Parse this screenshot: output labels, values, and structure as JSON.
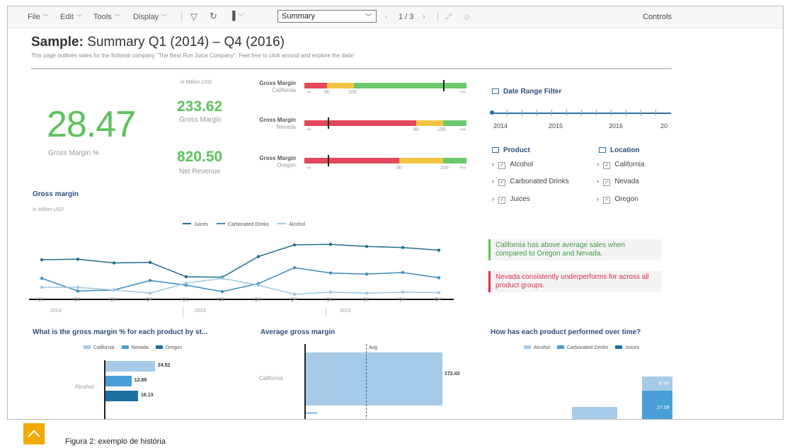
{
  "toolbar": {
    "file": "File",
    "edit": "Edit",
    "tools": "Tools",
    "display": "Display",
    "page_select": "Summary",
    "pager": "1 / 3",
    "controls": "Controls"
  },
  "header": {
    "title_bold": "Sample:",
    "title_rest": " Summary Q1 (2014) – Q4 (2016)",
    "description": "This page outlines sales for the fictional company \"The Best Run Juice Company\". Feel free to click around and explore the data!"
  },
  "kpis": {
    "unit": "in Million USD",
    "gross_margin_pct_value": "28.47",
    "gross_margin_pct_label": "Gross Margin %",
    "gross_margin_value": "233.62",
    "gross_margin_label": "Gross Margin",
    "net_revenue_value": "820.50",
    "net_revenue_label": "Net Revenue"
  },
  "bullets": [
    {
      "title": "Gross Margin",
      "location": "California",
      "ticks": [
        "-∞",
        "80",
        "100",
        "+∞"
      ],
      "marker_pct": 0.93
    },
    {
      "title": "Gross Margin",
      "location": "Nevada",
      "ticks": [
        "-∞",
        "80",
        "100",
        "+∞"
      ],
      "marker_pct": 0.15
    },
    {
      "title": "Gross Margin",
      "location": "Oregon",
      "ticks": [
        "-∞",
        "80",
        "100",
        "+∞"
      ],
      "marker_pct": 0.15
    }
  ],
  "filters": {
    "date_title": "Date Range Filter",
    "years": [
      "2014",
      "2015",
      "2016",
      "20"
    ],
    "product_title": "Product",
    "products": [
      "Alcohol",
      "Carbonated Drinks",
      "Juices"
    ],
    "location_title": "Location",
    "locations": [
      "California",
      "Nevada",
      "Oregon"
    ]
  },
  "notes": {
    "green": "California has above average sales when compared to Oregon and Nevada.",
    "red": "Nevada consistently underperforms for across all product groups.",
    "green_color": "#5dc25d",
    "red_color": "#d9304f"
  },
  "gross_margin_chart": {
    "title": "Gross margin",
    "unit": "in Million USD",
    "quarters": [
      "Q1",
      "Q2",
      "Q3",
      "Q4",
      "Q1",
      "Q2",
      "Q3",
      "Q4",
      "Q1",
      "Q2",
      "Q3",
      "Q4"
    ],
    "years": [
      "2014",
      "2015",
      "2016"
    ]
  },
  "bottom": {
    "chart1_title": "What is the gross margin % for each product by st...",
    "chart1_category": "Alcohol",
    "chart2_title": "Average gross margin",
    "chart2_category": "California",
    "chart2_avg": "Avg",
    "chart3_title": "How has each product performed over time?"
  },
  "chart_data": [
    {
      "type": "line",
      "title": "Gross margin",
      "ylabel": "in Million USD",
      "x": [
        "Q1 2014",
        "Q2 2014",
        "Q3 2014",
        "Q4 2014",
        "Q1 2015",
        "Q2 2015",
        "Q3 2015",
        "Q4 2015",
        "Q1 2016",
        "Q2 2016",
        "Q3 2016",
        "Q4 2016"
      ],
      "ylim": [
        0,
        100
      ],
      "series": [
        {
          "name": "Juices",
          "color": "#1f6f8b",
          "values": [
            72,
            73,
            66,
            67,
            40,
            39,
            78,
            100,
            101,
            97,
            95,
            90
          ]
        },
        {
          "name": "Carbonated Drinks",
          "color": "#3a8dbf",
          "values": [
            37,
            13,
            15,
            33,
            24,
            12,
            27,
            57,
            47,
            45,
            48,
            38
          ]
        },
        {
          "name": "Alcohol",
          "color": "#9fc6e0",
          "values": [
            20,
            20,
            15,
            9,
            28,
            37,
            24,
            7,
            11,
            9,
            11,
            10
          ]
        }
      ]
    },
    {
      "type": "bar",
      "title": "What is the gross margin % for each product by st...",
      "categories": [
        "Alcohol"
      ],
      "series": [
        {
          "name": "California",
          "color": "#a6cbe8",
          "values": [
            24.52
          ]
        },
        {
          "name": "Nevada",
          "color": "#4a9fd6",
          "values": [
            12.88
          ]
        },
        {
          "name": "Oregon",
          "color": "#1f6fa3",
          "values": [
            16.13
          ]
        }
      ],
      "value_labels": [
        "24.52",
        "12.88",
        "16.13"
      ]
    },
    {
      "type": "bar",
      "title": "Average gross margin",
      "categories": [
        "California"
      ],
      "values": [
        172.43
      ],
      "value_labels": [
        "172.43"
      ],
      "reference_line": "Avg"
    },
    {
      "type": "bar",
      "title": "How has each product performed over time?",
      "series": [
        {
          "name": "Alcohol",
          "color": "#a6cbe8"
        },
        {
          "name": "Carbonated Drinks",
          "color": "#4a9fd6"
        },
        {
          "name": "Juices",
          "color": "#1f6fa3"
        }
      ],
      "value_labels": [
        "8.78",
        "27.09"
      ]
    }
  ],
  "caption": "Figura 2: exemplo de história"
}
